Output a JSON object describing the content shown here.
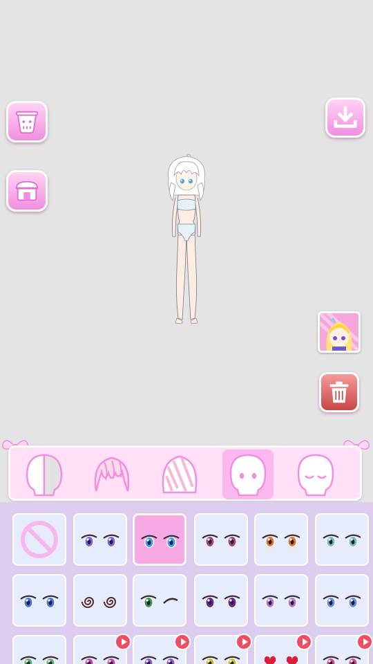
{
  "colors": {
    "background": "#e4e4e4",
    "accent_pink": "#f08fe0",
    "selected_tile": "#f6a9e3",
    "tile": "#e6ecfb",
    "grid_bg": "#dccdee",
    "ad_badge": "#f04d62"
  },
  "toolbar": {
    "left": [
      {
        "name": "clear-outfit",
        "icon": "trash-cup-icon"
      },
      {
        "name": "shop",
        "icon": "shop-icon"
      }
    ],
    "right": [
      {
        "name": "download",
        "icon": "download-icon"
      },
      {
        "name": "character-gallery",
        "icon": "character-thumbnail"
      },
      {
        "name": "delete",
        "icon": "trash-icon"
      }
    ]
  },
  "categories": [
    {
      "name": "skin",
      "icon": "half-head-icon",
      "active": false
    },
    {
      "name": "hair-front",
      "icon": "hair-front-icon",
      "active": false
    },
    {
      "name": "hair-back",
      "icon": "hair-back-icon",
      "active": false
    },
    {
      "name": "eyes",
      "icon": "eyes-head-icon",
      "active": true
    },
    {
      "name": "closed-eyes",
      "icon": "closed-eyes-head-icon",
      "active": false
    }
  ],
  "eye_options": [
    {
      "type": "none"
    },
    {
      "type": "eye",
      "iris": "#7a6ad6",
      "ad": false
    },
    {
      "type": "eye",
      "iris": "#3aa0e8",
      "ad": false,
      "selected": true
    },
    {
      "type": "eye",
      "iris": "#a0487a",
      "ad": false
    },
    {
      "type": "eye",
      "iris": "#e0781e",
      "ad": false
    },
    {
      "type": "eye",
      "iris": "#6fc0b8",
      "ad": false
    },
    {
      "type": "eye",
      "iris": "#4a7ad8",
      "ad": false
    },
    {
      "type": "spiral",
      "iris": "#5a2a2a",
      "ad": false
    },
    {
      "type": "wink",
      "iris": "#3a9a4a",
      "ad": false
    },
    {
      "type": "eye",
      "iris": "#6a2a8a",
      "ad": false
    },
    {
      "type": "eye",
      "iris": "#b07ad0",
      "ad": false
    },
    {
      "type": "eye",
      "iris": "#6a90d8",
      "ad": false
    },
    {
      "type": "eye",
      "iris": "#60b070",
      "ad": false
    },
    {
      "type": "eye",
      "iris": "#c04ab0",
      "ad": true
    },
    {
      "type": "eye",
      "iris": "#8a5ac8",
      "ad": true
    },
    {
      "type": "eye",
      "iris": "#c0c020",
      "ad": true
    },
    {
      "type": "heart",
      "iris": "#d81f3a",
      "ad": true
    },
    {
      "type": "eye",
      "iris": "#d04a90",
      "ad": true
    }
  ]
}
